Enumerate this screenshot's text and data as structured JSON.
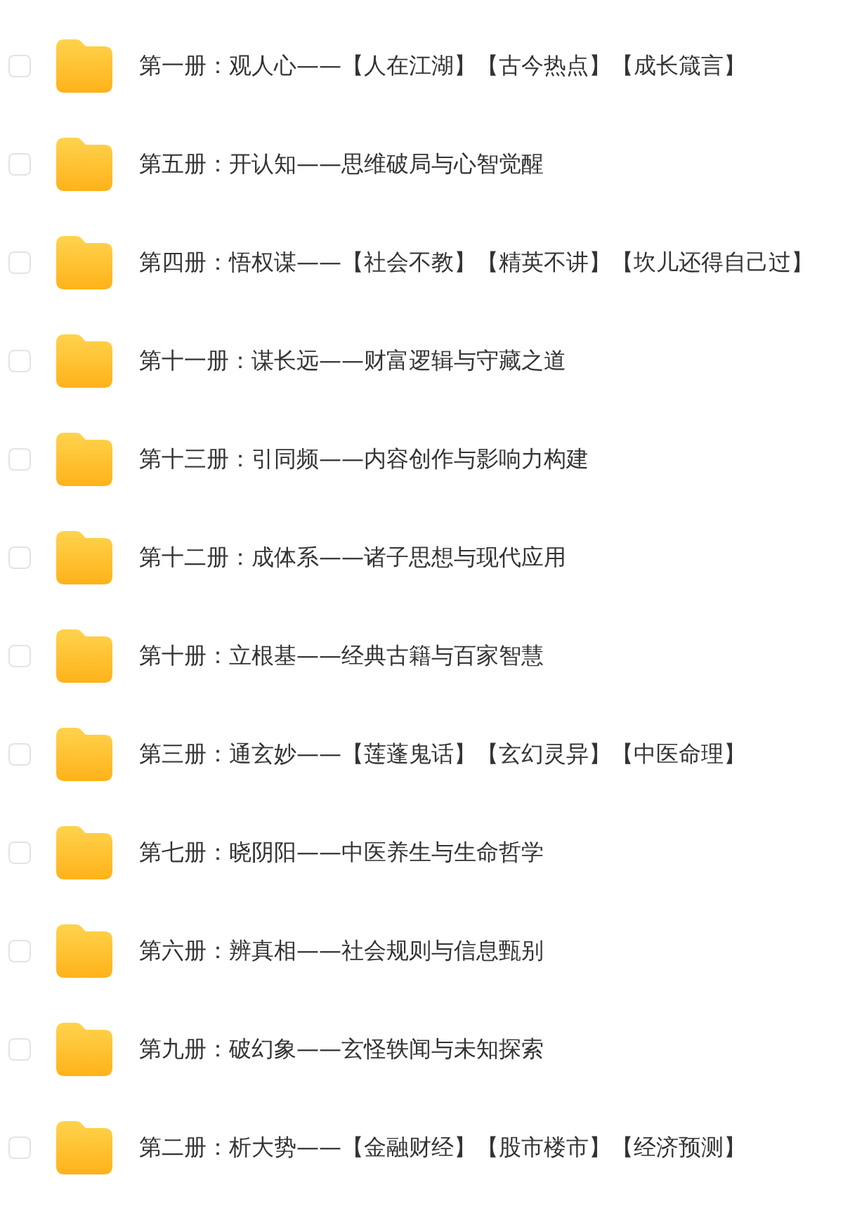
{
  "files": [
    {
      "name": "第一册：观人心——【人在江湖】【古今热点】【成长箴言】",
      "checked": false
    },
    {
      "name": "第五册：开认知——思维破局与心智觉醒",
      "checked": false
    },
    {
      "name": "第四册：悟权谋——【社会不教】【精英不讲】【坎儿还得自己过】",
      "checked": false
    },
    {
      "name": "第十一册：谋长远——财富逻辑与守藏之道",
      "checked": false
    },
    {
      "name": "第十三册：引同频——内容创作与影响力构建",
      "checked": false
    },
    {
      "name": "第十二册：成体系——诸子思想与现代应用",
      "checked": false
    },
    {
      "name": "第十册：立根基——经典古籍与百家智慧",
      "checked": false
    },
    {
      "name": "第三册：通玄妙——【莲蓬鬼话】【玄幻灵异】【中医命理】",
      "checked": false
    },
    {
      "name": "第七册：晓阴阳——中医养生与生命哲学",
      "checked": false
    },
    {
      "name": "第六册：辨真相——社会规则与信息甄别",
      "checked": false
    },
    {
      "name": "第九册：破幻象——玄怪轶闻与未知探索",
      "checked": false
    },
    {
      "name": "第二册：析大势——【金融财经】【股市楼市】【经济预测】",
      "checked": false
    }
  ]
}
